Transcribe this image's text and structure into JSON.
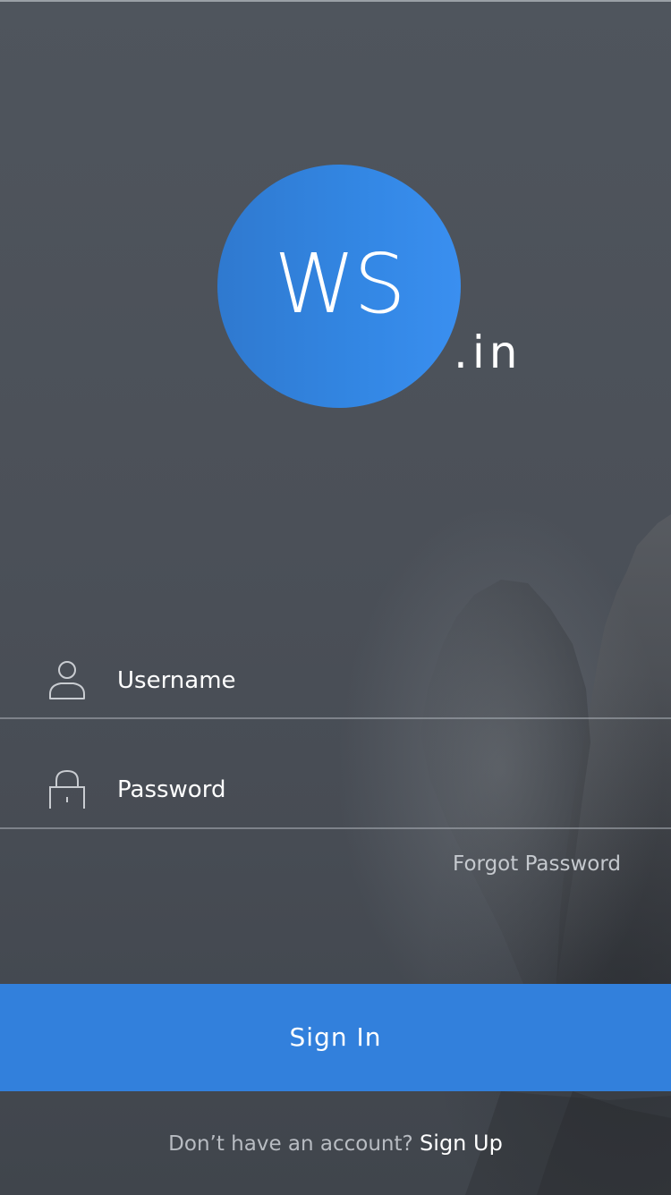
{
  "logo": {
    "initials": "WS",
    "suffix": ".in"
  },
  "form": {
    "username_placeholder": "Username",
    "password_placeholder": "Password",
    "forgot_password": "Forgot Password"
  },
  "actions": {
    "sign_in": "Sign In"
  },
  "footer": {
    "prompt": "Don’t have an account?",
    "signup_link": "Sign Up"
  },
  "icons": {
    "username": "user-icon",
    "password": "lock-icon"
  },
  "colors": {
    "accent": "#3280dc",
    "logo_gradient_start": "#2f79cf",
    "logo_gradient_end": "#3a8ff0",
    "background": "#4b5058",
    "muted_text": "#c5c9ce"
  }
}
